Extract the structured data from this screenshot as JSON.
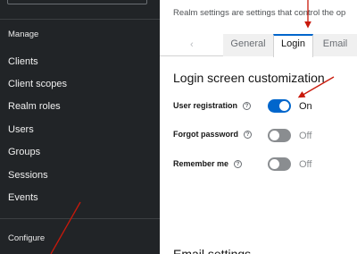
{
  "sidebar": {
    "sections": [
      {
        "label": "Manage"
      },
      {
        "label": "Configure"
      }
    ],
    "items": [
      {
        "label": "Clients"
      },
      {
        "label": "Client scopes"
      },
      {
        "label": "Realm roles"
      },
      {
        "label": "Users"
      },
      {
        "label": "Groups"
      },
      {
        "label": "Sessions"
      },
      {
        "label": "Events"
      }
    ]
  },
  "main": {
    "subtitle": "Realm settings are settings that control the op",
    "tabs": [
      {
        "label": "General"
      },
      {
        "label": "Login"
      },
      {
        "label": "Email"
      }
    ],
    "active_tab": "Login",
    "section_title": "Login screen customization",
    "settings": [
      {
        "label": "User registration",
        "state": "On",
        "enabled": true
      },
      {
        "label": "Forgot password",
        "state": "Off",
        "enabled": false
      },
      {
        "label": "Remember me",
        "state": "Off",
        "enabled": false
      }
    ],
    "next_section_partial": "Email settings"
  },
  "colors": {
    "sidebar_bg": "#212427",
    "accent": "#0066cc",
    "annotation_arrow": "#c9190b"
  },
  "icons": {
    "tab_scroll": "chevron-left-icon",
    "help": "question-circle-icon"
  }
}
